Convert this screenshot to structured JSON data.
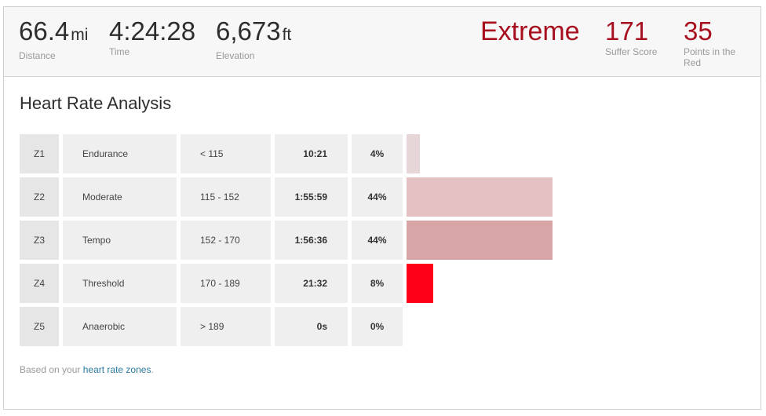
{
  "header": {
    "stats": [
      {
        "value": "66.4",
        "unit": "mi",
        "label": "Distance"
      },
      {
        "value": "4:24:28",
        "unit": "",
        "label": "Time"
      },
      {
        "value": "6,673",
        "unit": "ft",
        "label": "Elevation"
      }
    ],
    "intensity": "Extreme",
    "suffer_score": {
      "value": "171",
      "label": "Suffer Score"
    },
    "points_in_red": {
      "value": "35",
      "label": "Points in the Red"
    }
  },
  "analysis": {
    "title": "Heart Rate Analysis",
    "zones": [
      {
        "zone": "Z1",
        "name": "Endurance",
        "range": "< 115",
        "time": "10:21",
        "percent": "4%",
        "pct_value": 4,
        "bar_color": "#e6d6d8"
      },
      {
        "zone": "Z2",
        "name": "Moderate",
        "range": "115 - 152",
        "time": "1:55:59",
        "percent": "44%",
        "pct_value": 44,
        "bar_color": "#e4c1c2"
      },
      {
        "zone": "Z3",
        "name": "Tempo",
        "range": "152 - 170",
        "time": "1:56:36",
        "percent": "44%",
        "pct_value": 44,
        "bar_color": "#d8a5a6"
      },
      {
        "zone": "Z4",
        "name": "Threshold",
        "range": "170 - 189",
        "time": "21:32",
        "percent": "8%",
        "pct_value": 8,
        "bar_color": "#ff0019"
      },
      {
        "zone": "Z5",
        "name": "Anaerobic",
        "range": "> 189",
        "time": "0s",
        "percent": "0%",
        "pct_value": 0,
        "bar_color": "#ff0019"
      }
    ],
    "note_prefix": "Based on your ",
    "note_link": "heart rate zones",
    "note_suffix": "."
  }
}
